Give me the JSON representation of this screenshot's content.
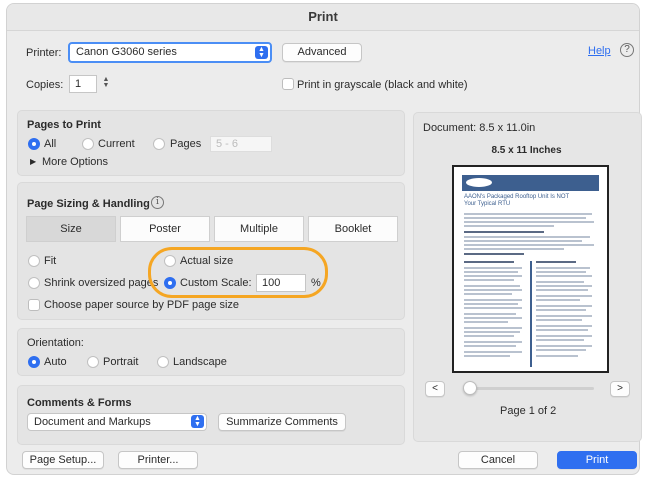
{
  "window": {
    "title": "Print"
  },
  "printer": {
    "label": "Printer:",
    "value": "Canon G3060 series",
    "advanced_label": "Advanced"
  },
  "help": {
    "link": "Help",
    "icon": "help-circle-icon"
  },
  "copies": {
    "label": "Copies:",
    "value": "1",
    "grayscale_label": "Print in grayscale (black and white)",
    "grayscale_checked": false
  },
  "pages_to_print": {
    "title": "Pages to Print",
    "all_label": "All",
    "current_label": "Current",
    "pages_label": "Pages",
    "pages_placeholder": "5 - 6",
    "selected": "all",
    "more_options_label": "More Options"
  },
  "sizing": {
    "title": "Page Sizing & Handling",
    "tabs": [
      {
        "label": "Size",
        "active": true
      },
      {
        "label": "Poster",
        "active": false
      },
      {
        "label": "Multiple",
        "active": false
      },
      {
        "label": "Booklet",
        "active": false
      }
    ],
    "fit_label": "Fit",
    "actual_size_label": "Actual size",
    "shrink_label": "Shrink oversized pages",
    "custom_scale_label": "Custom Scale:",
    "custom_scale_value": "100",
    "percent_label": "%",
    "selected": "custom-scale",
    "paper_source_label": "Choose paper source by PDF page size",
    "paper_source_checked": false
  },
  "orientation": {
    "title": "Orientation:",
    "auto_label": "Auto",
    "portrait_label": "Portrait",
    "landscape_label": "Landscape",
    "selected": "auto"
  },
  "comments": {
    "title": "Comments & Forms",
    "value": "Document and Markups",
    "summarize_label": "Summarize Comments"
  },
  "preview": {
    "document_label": "Document: 8.5 x 11.0in",
    "paper_label": "8.5 x 11 Inches",
    "prev_label": "<",
    "next_label": ">",
    "page_indicator": "Page 1 of 2",
    "doc_heading": "AAON's Packaged Rooftop Unit Is NOT Your Typical RTU"
  },
  "footer": {
    "page_setup_label": "Page Setup...",
    "printer_label": "Printer...",
    "cancel_label": "Cancel",
    "print_label": "Print"
  },
  "colors": {
    "accent": "#2f6ff0",
    "highlight": "#f5a623"
  }
}
